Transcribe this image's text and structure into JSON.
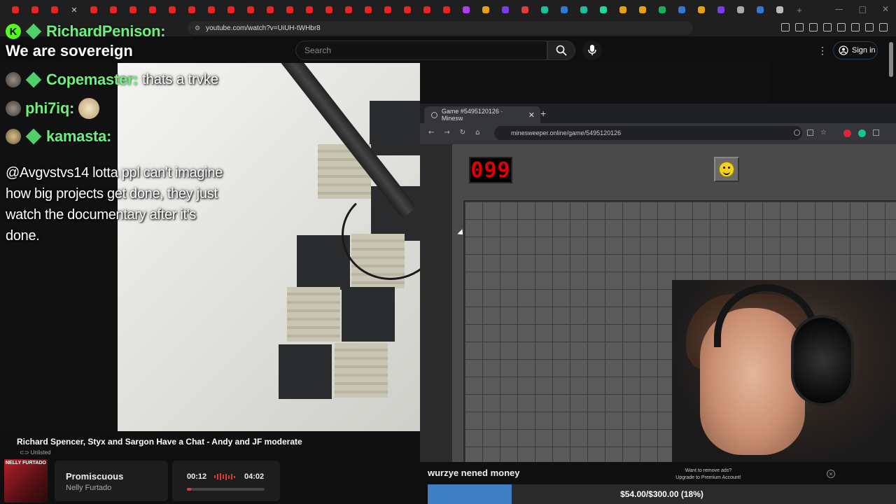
{
  "browser": {
    "url": "youtube.com/watch?v=UiUH-tWHbr8"
  },
  "youtube": {
    "search_placeholder": "Search",
    "signin_label": "Sign in"
  },
  "chat": {
    "streamer_line": {
      "name": "RichardPenison:"
    },
    "banner": "We are sovereign",
    "messages": [
      {
        "name": "Copemaster:",
        "text": "thats a trvke"
      },
      {
        "name": "phi7iq:",
        "text": ""
      },
      {
        "name": "kamasta:",
        "text": ""
      }
    ],
    "big_message": "@Avgvstvs14 lotta ppl can't imagine how big projects get done, they just watch the documentary after it's done."
  },
  "minesweeper": {
    "tab_title": "Game #5495120126 · Minesw",
    "url": "minesweeper.online/game/5495120126",
    "mine_counter": "099"
  },
  "video": {
    "title": "Richard Spencer, Styx and Sargon Have a Chat - Andy and JF moderate",
    "visibility": "Unlisted"
  },
  "now_playing": {
    "album_text": "NELLY FURTADO",
    "song": "Promiscuous",
    "artist": "Nelly Furtado",
    "current_time": "00:12",
    "total_time": "04:02",
    "progress_fraction": 0.05
  },
  "stream_overlay": {
    "chat_message": "wurzye nened money",
    "ad_text_1": "Want to remove ads?",
    "ad_text_2": "Upgrade to Premium Account!",
    "goal_text": "$54.00/$300.00 (18%)",
    "goal_fraction": 0.18
  },
  "colors": {
    "chat_name": "#6cf07a",
    "kick_green": "#53fc18",
    "goal_blue": "#3e7fc4",
    "counter_red": "#e00000"
  }
}
